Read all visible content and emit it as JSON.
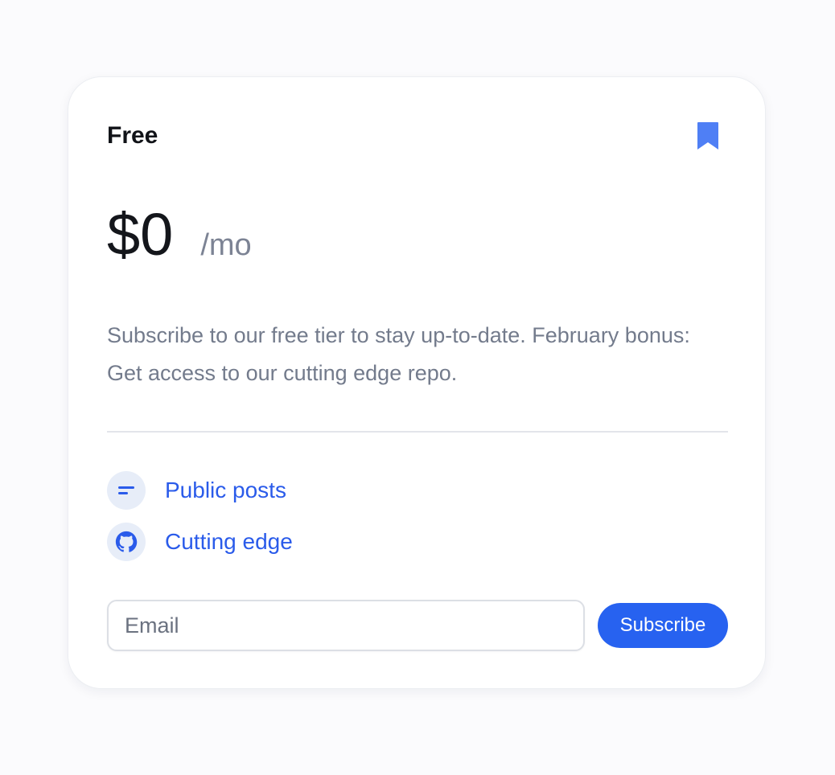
{
  "card": {
    "tier_name": "Free",
    "price": "$0",
    "period": "/mo",
    "description": "Subscribe to our free tier to stay up-to-date. February bonus: Get access to our cutting edge repo.",
    "bookmark_icon": "bookmark-icon"
  },
  "features": [
    {
      "label": "Public posts",
      "icon": "posts-lines-icon"
    },
    {
      "label": "Cutting edge",
      "icon": "github-icon"
    }
  ],
  "subscribe": {
    "email_placeholder": "Email",
    "email_value": "",
    "button_label": "Subscribe"
  },
  "colors": {
    "accent": "#2762f0",
    "feature_text": "#2a5bea",
    "bookmark": "#4f7ff5",
    "muted_text": "#737b8c",
    "icon_bg": "#e7edf8"
  }
}
